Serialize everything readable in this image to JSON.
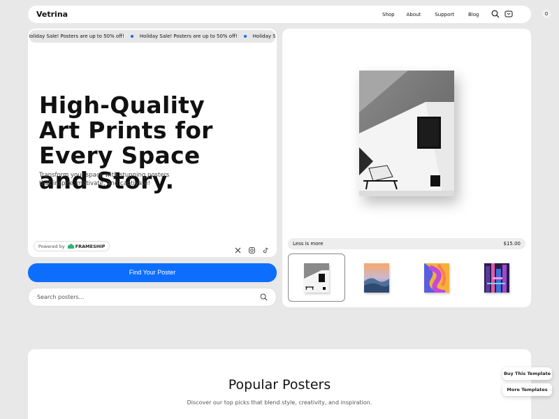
{
  "nav": {
    "logo": "Vetrina",
    "links": [
      "Shop",
      "About",
      "Support",
      "Blog"
    ],
    "cart_count": "0"
  },
  "ticker": {
    "items": [
      "Holiday Sale! Posters are up to 50% off!",
      "Holiday Sale! Posters are up to 50% off!",
      "Holiday Sale! Posters are up to 50% off!"
    ],
    "accent": "#0b6bff"
  },
  "hero": {
    "title": "High-Quality Art Prints for Every Space and Story.",
    "subtitle": "Transform your space with stunning posters that inspire, motivate, and captivate!",
    "powered_by": "Powered by",
    "brand": "FRAMESHIP",
    "socials": [
      "x-icon",
      "instagram-icon",
      "tiktok-icon"
    ]
  },
  "cta": {
    "label": "Find Your Poster",
    "color": "#0d6efd"
  },
  "search": {
    "placeholder": "Search posters..."
  },
  "product": {
    "name": "Less is more",
    "price": "$15.00",
    "thumbnails": [
      "Less is more",
      "mountain mist",
      "abstract swirl",
      "neon city"
    ]
  },
  "popular": {
    "title": "Popular Posters",
    "subtitle": "Discover our top picks that blend style, creativity, and inspiration."
  },
  "floating": {
    "buy": "Buy This Template",
    "more": "More Templates"
  }
}
